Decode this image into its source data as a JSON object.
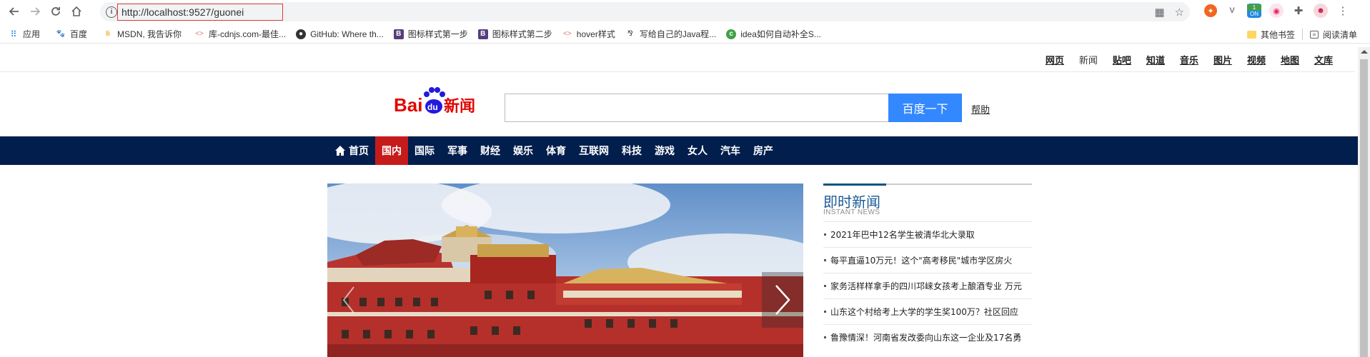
{
  "browser": {
    "url": "http://localhost:9527/guonei",
    "bookmarks": [
      {
        "label": "应用",
        "icon": "apps-icon"
      },
      {
        "label": "百度",
        "icon": "baidu-icon"
      },
      {
        "label": "MSDN, 我告诉你",
        "icon": "msdn-icon"
      },
      {
        "label": "库-cdnjs.com-最佳...",
        "icon": "code-icon"
      },
      {
        "label": "GitHub: Where th...",
        "icon": "github-icon"
      },
      {
        "label": "图标样式第一步",
        "icon": "bootstrap-icon"
      },
      {
        "label": "图标样式第二步",
        "icon": "bootstrap-icon"
      },
      {
        "label": "hover样式",
        "icon": "code-icon"
      },
      {
        "label": "写给自己的Java程...",
        "icon": "feather-icon"
      },
      {
        "label": "idea如何自动补全S...",
        "icon": "c-icon"
      }
    ],
    "other_bookmarks": "其他书签",
    "reading_list": "阅读清单",
    "ext_badge": "ON"
  },
  "top_links": [
    "网页",
    "新闻",
    "贴吧",
    "知道",
    "音乐",
    "图片",
    "视频",
    "地图",
    "文库"
  ],
  "logo": {
    "bai": "Bai",
    "du": "du",
    "news": "新闻"
  },
  "search": {
    "button": "百度一下",
    "help": "帮助"
  },
  "channels": [
    "首页",
    "国内",
    "国际",
    "军事",
    "财经",
    "娱乐",
    "体育",
    "互联网",
    "科技",
    "游戏",
    "女人",
    "汽车",
    "房产"
  ],
  "instant_news": {
    "title": "即时新闻",
    "subtitle": "INSTANT NEWS",
    "items": [
      "2021年巴中12名学生被清华北大录取",
      "每平直逼10万元！这个\"高考移民\"城市学区房火",
      "家务活样样拿手的四川邛崃女孩考上酿酒专业 万元",
      "山东这个村给考上大学的学生奖100万？社区回应",
      "鲁豫情深！河南省发改委向山东这一企业及17名勇"
    ]
  },
  "colors": {
    "nav_bg": "#021e4d",
    "active_channel": "#c61b1b",
    "search_btn": "#3388ff",
    "news_title": "#1b5b97"
  }
}
